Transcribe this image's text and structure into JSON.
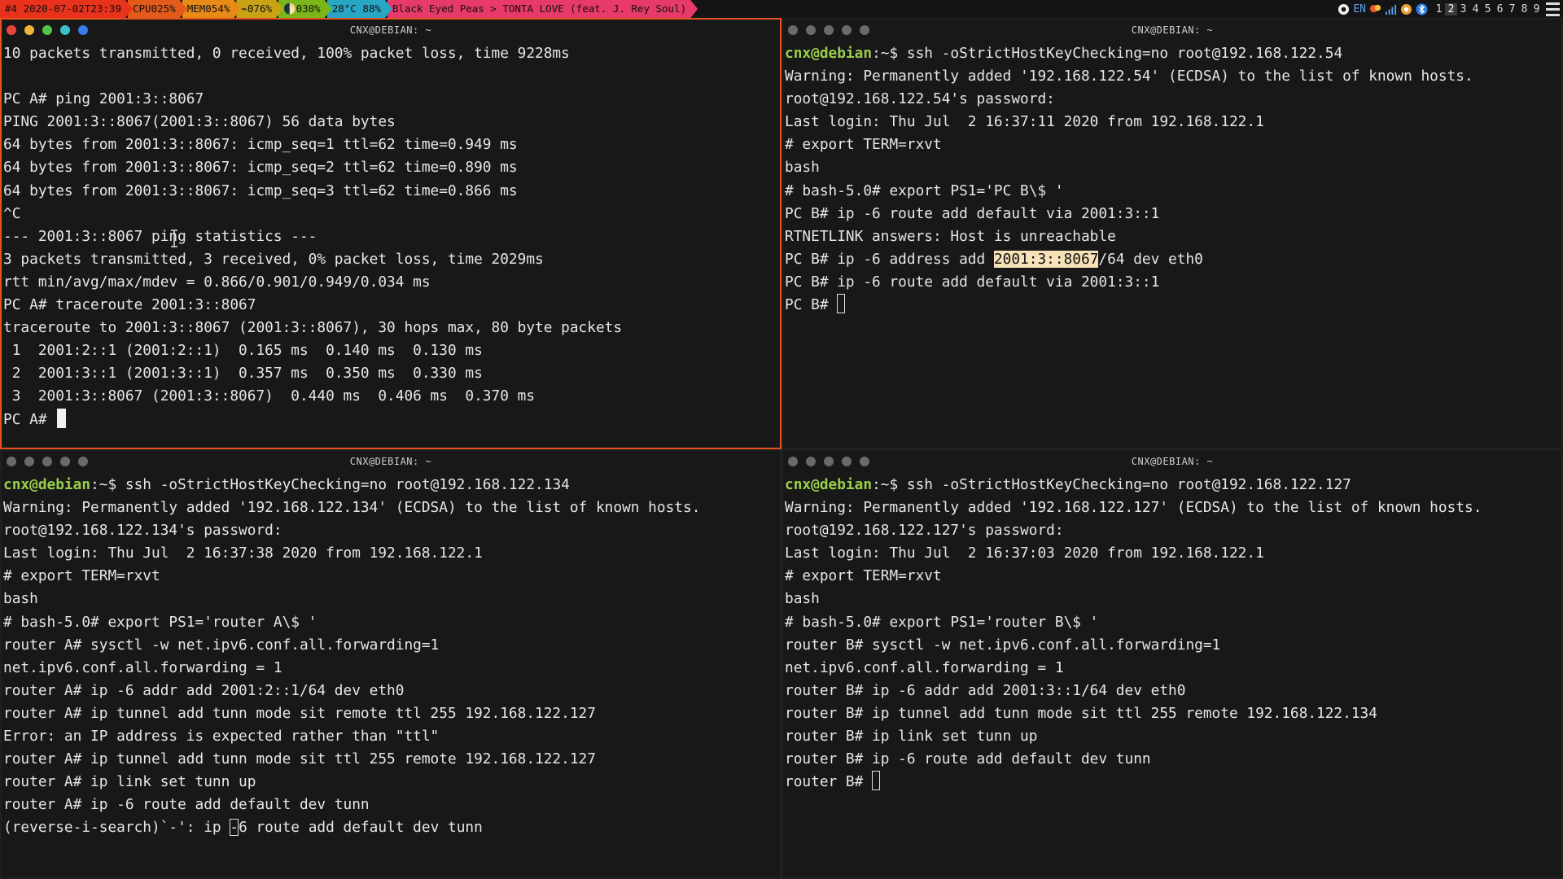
{
  "topbar": {
    "segments": [
      {
        "text": "#4 2020-07-02T23:39",
        "bg": "#e8321c"
      },
      {
        "text": "CPU025%",
        "bg": "#e35a1a"
      },
      {
        "text": "MEM054%",
        "bg": "#e88a16"
      },
      {
        "text": "⌁076%",
        "bg": "#c8a316"
      },
      {
        "text": "🌓030%",
        "bg": "#7ab61a"
      },
      {
        "text": "28°C 88%",
        "bg": "#28a7c4"
      },
      {
        "text": "Black Eyed Peas > TONTA LOVE (feat. J. Rey Soul)",
        "bg": "#e83a6a"
      }
    ],
    "tray": {
      "lang": "EN"
    },
    "workspaces": [
      "1",
      "2",
      "3",
      "4",
      "5",
      "6",
      "7",
      "8",
      "9"
    ],
    "active_workspace_index": 1
  },
  "colors": {
    "focus_border": "#e8521c",
    "user_prompt": "#9ace4a",
    "selection_highlight": "#f7e2b8"
  },
  "terminals": [
    {
      "title": "CNX@DEBIAN: ~",
      "focused": true,
      "lines": [
        [
          {
            "t": "10 packets transmitted, 0 received, 100% packet loss, time 9228ms"
          }
        ],
        [
          {
            "t": ""
          }
        ],
        [
          {
            "t": "PC A# ping 2001:3::8067"
          }
        ],
        [
          {
            "t": "PING 2001:3::8067(2001:3::8067) 56 data bytes"
          }
        ],
        [
          {
            "t": "64 bytes from 2001:3::8067: icmp_seq=1 ttl=62 time=0.949 ms"
          }
        ],
        [
          {
            "t": "64 bytes from 2001:3::8067: icmp_seq=2 ttl=62 time=0.890 ms"
          }
        ],
        [
          {
            "t": "64 bytes from 2001:3::8067: icmp_seq=3 ttl=62 time=0.866 ms"
          }
        ],
        [
          {
            "t": "^C"
          }
        ],
        [
          {
            "t": "--- 2001:3::8067 ping statistics ---"
          }
        ],
        [
          {
            "t": "3 packets transmitted, 3 received, 0% packet loss, time 2029ms"
          }
        ],
        [
          {
            "t": "rtt min/avg/max/mdev = 0.866/0.901/0.949/0.034 ms"
          }
        ],
        [
          {
            "t": "PC A# traceroute 2001:3::8067"
          }
        ],
        [
          {
            "t": "traceroute to 2001:3::8067 (2001:3::8067), 30 hops max, 80 byte packets"
          }
        ],
        [
          {
            "t": " 1  2001:2::1 (2001:2::1)  0.165 ms  0.140 ms  0.130 ms"
          }
        ],
        [
          {
            "t": " 2  2001:3::1 (2001:3::1)  0.357 ms  0.350 ms  0.330 ms"
          }
        ],
        [
          {
            "t": " 3  2001:3::8067 (2001:3::8067)  0.440 ms  0.406 ms  0.370 ms"
          }
        ],
        [
          {
            "t": "PC A# "
          },
          {
            "cursor": "block"
          }
        ]
      ]
    },
    {
      "title": "CNX@DEBIAN: ~",
      "focused": false,
      "lines": [
        [
          {
            "t": "cnx@debian",
            "c": "user"
          },
          {
            "t": ":~$ ssh -oStrictHostKeyChecking=no root@192.168.122.54"
          }
        ],
        [
          {
            "t": "Warning: Permanently added '192.168.122.54' (ECDSA) to the list of known hosts."
          }
        ],
        [
          {
            "t": "root@192.168.122.54's password:"
          }
        ],
        [
          {
            "t": "Last login: Thu Jul  2 16:37:11 2020 from 192.168.122.1"
          }
        ],
        [
          {
            "t": "# export TERM=rxvt"
          }
        ],
        [
          {
            "t": "bash"
          }
        ],
        [
          {
            "t": "# bash-5.0# export PS1='PC B\\$ '"
          }
        ],
        [
          {
            "t": "PC B# ip -6 route add default via 2001:3::1"
          }
        ],
        [
          {
            "t": "RTNETLINK answers: Host is unreachable"
          }
        ],
        [
          {
            "t": "PC B# ip -6 address add "
          },
          {
            "t": "2001:3::8067",
            "c": "hl"
          },
          {
            "t": "/64 dev eth0"
          }
        ],
        [
          {
            "t": "PC B# ip -6 route add default via 2001:3::1"
          }
        ],
        [
          {
            "t": "PC B# "
          },
          {
            "cursor": "hollow"
          }
        ]
      ]
    },
    {
      "title": "CNX@DEBIAN: ~",
      "focused": false,
      "lines": [
        [
          {
            "t": "cnx@debian",
            "c": "user"
          },
          {
            "t": ":~$ ssh -oStrictHostKeyChecking=no root@192.168.122.134"
          }
        ],
        [
          {
            "t": "Warning: Permanently added '192.168.122.134' (ECDSA) to the list of known hosts."
          }
        ],
        [
          {
            "t": "root@192.168.122.134's password:"
          }
        ],
        [
          {
            "t": "Last login: Thu Jul  2 16:37:38 2020 from 192.168.122.1"
          }
        ],
        [
          {
            "t": "# export TERM=rxvt"
          }
        ],
        [
          {
            "t": "bash"
          }
        ],
        [
          {
            "t": "# bash-5.0# export PS1='router A\\$ '"
          }
        ],
        [
          {
            "t": "router A# sysctl -w net.ipv6.conf.all.forwarding=1"
          }
        ],
        [
          {
            "t": "net.ipv6.conf.all.forwarding = 1"
          }
        ],
        [
          {
            "t": "router A# ip -6 addr add 2001:2::1/64 dev eth0"
          }
        ],
        [
          {
            "t": "router A# ip tunnel add tunn mode sit remote ttl 255 192.168.122.127"
          }
        ],
        [
          {
            "t": "Error: an IP address is expected rather than \"ttl\""
          }
        ],
        [
          {
            "t": "router A# ip tunnel add tunn mode sit ttl 255 remote 192.168.122.127"
          }
        ],
        [
          {
            "t": "router A# ip link set tunn up"
          }
        ],
        [
          {
            "t": "router A# ip -6 route add default dev tunn"
          }
        ],
        [
          {
            "t": "(reverse-i-search)`-': ip "
          },
          {
            "t": "-",
            "c": "hollowchar"
          },
          {
            "t": "6 route add default dev tunn"
          }
        ]
      ]
    },
    {
      "title": "CNX@DEBIAN: ~",
      "focused": false,
      "lines": [
        [
          {
            "t": "cnx@debian",
            "c": "user"
          },
          {
            "t": ":~$ ssh -oStrictHostKeyChecking=no root@192.168.122.127"
          }
        ],
        [
          {
            "t": "Warning: Permanently added '192.168.122.127' (ECDSA) to the list of known hosts."
          }
        ],
        [
          {
            "t": "root@192.168.122.127's password:"
          }
        ],
        [
          {
            "t": "Last login: Thu Jul  2 16:37:03 2020 from 192.168.122.1"
          }
        ],
        [
          {
            "t": "# export TERM=rxvt"
          }
        ],
        [
          {
            "t": "bash"
          }
        ],
        [
          {
            "t": "# bash-5.0# export PS1='router B\\$ '"
          }
        ],
        [
          {
            "t": "router B# sysctl -w net.ipv6.conf.all.forwarding=1"
          }
        ],
        [
          {
            "t": "net.ipv6.conf.all.forwarding = 1"
          }
        ],
        [
          {
            "t": "router B# ip -6 addr add 2001:3::1/64 dev eth0"
          }
        ],
        [
          {
            "t": "router B# ip tunnel add tunn mode sit ttl 255 remote 192.168.122.134"
          }
        ],
        [
          {
            "t": "router B# ip link set tunn up"
          }
        ],
        [
          {
            "t": "router B# ip -6 route add default dev tunn"
          }
        ],
        [
          {
            "t": "router B# "
          },
          {
            "cursor": "hollow"
          }
        ]
      ]
    }
  ]
}
